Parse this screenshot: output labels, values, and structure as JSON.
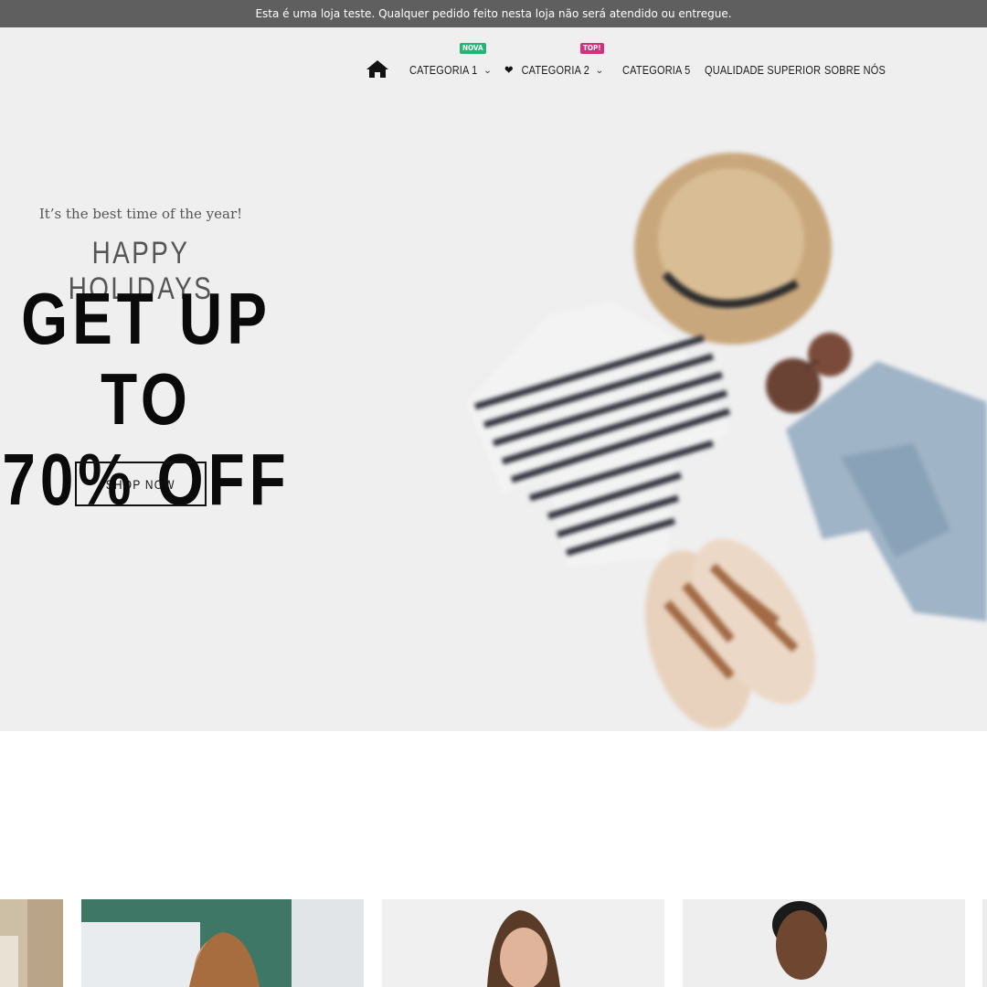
{
  "notice": {
    "text": "Esta é uma loja teste. Qualquer pedido feito nesta loja não será atendido ou entregue."
  },
  "nav": {
    "items": [
      {
        "label": "CATEGORIA 1",
        "badge": "NOVA",
        "badge_color": "#22b573",
        "has_dropdown": true
      },
      {
        "label": "CATEGORIA 2",
        "badge": "TOP!",
        "badge_color": "#d6307a",
        "has_dropdown": true,
        "icon": "heart-icon"
      },
      {
        "label": "CATEGORIA 5"
      },
      {
        "label": "QUALIDADE SUPERIOR"
      },
      {
        "label": "SOBRE NÓS"
      }
    ],
    "home_icon": "home-icon"
  },
  "hero": {
    "eyebrow": "It’s the best time of the year!",
    "subtitle": "HAPPY HOLIDAYS",
    "headline_line1": "GET UP TO",
    "headline_line2": "70% OFF",
    "cta_label": "SHOP NOW",
    "background_color": "#efeff0"
  },
  "products": {
    "cards": [
      {
        "image": "product-image-partial"
      },
      {
        "image": "product-image-woman-green-wall"
      },
      {
        "image": "product-image-woman-portrait"
      },
      {
        "image": "product-image-man-portrait"
      }
    ]
  },
  "colors": {
    "notice_bg": "#5f5f5f",
    "text_dark": "#111111"
  }
}
